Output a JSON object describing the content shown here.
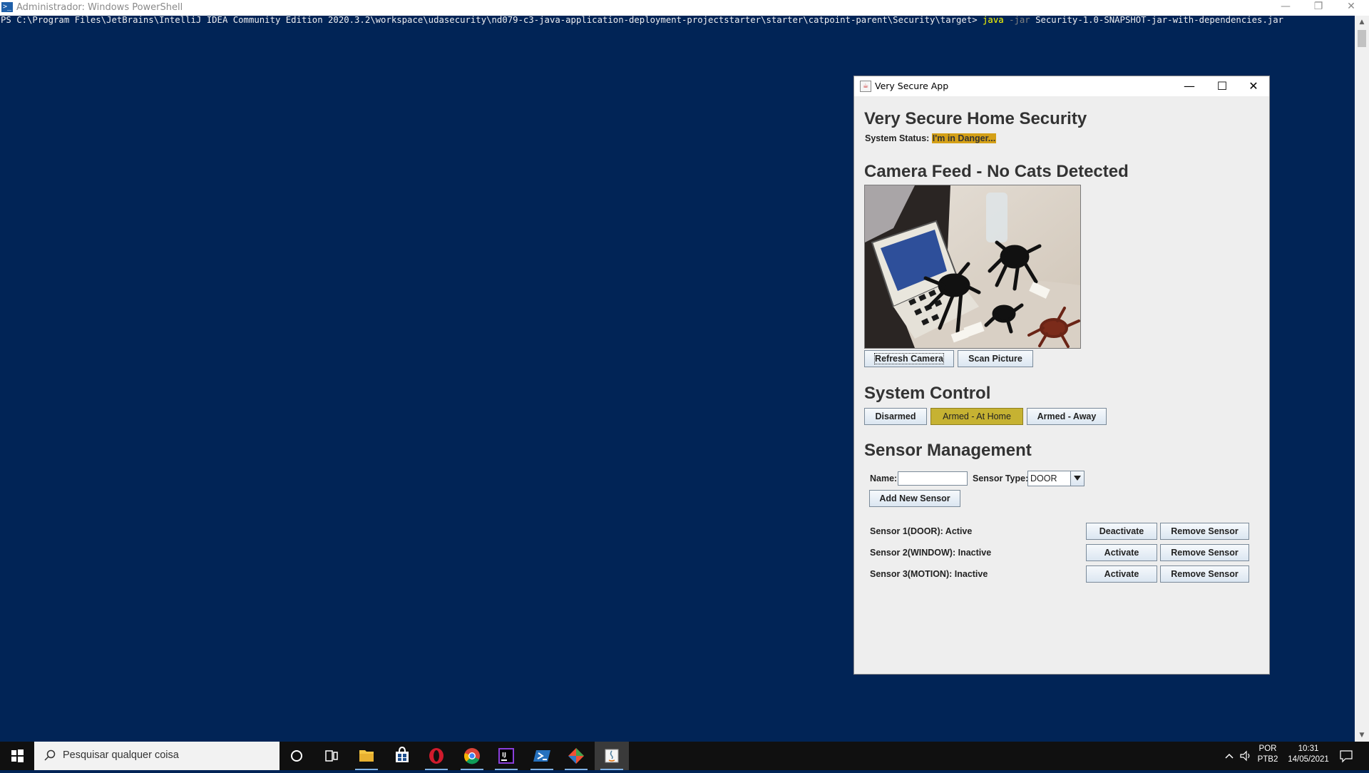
{
  "powershell": {
    "title": "Administrador: Windows PowerShell",
    "prompt": "PS C:\\Program Files\\JetBrains\\IntelliJ IDEA Community Edition 2020.3.2\\workspace\\udasecurity\\nd079-c3-java-application-deployment-projectstarter\\starter\\catpoint-parent\\Security\\target> ",
    "command": "java",
    "param": "-jar",
    "argument": "Security-1.0-SNAPSHOT-jar-with-dependencies.jar",
    "minimize": "—",
    "restore": "❐",
    "close": "✕"
  },
  "app": {
    "title": "Very Secure App",
    "minimize": "—",
    "maximize": "☐",
    "close": "✕",
    "heading": "Very Secure Home Security",
    "status_label": "System Status:",
    "status_value": "I'm in Danger...",
    "camera_heading": "Camera Feed - No Cats Detected",
    "refresh_camera": "Refresh Camera",
    "scan_picture": "Scan Picture",
    "system_control_heading": "System Control",
    "btn_disarmed": "Disarmed",
    "btn_armed_home": "Armed - At Home",
    "btn_armed_away": "Armed - Away",
    "sensor_heading": "Sensor Management",
    "name_label": "Name:",
    "name_value": "",
    "sensor_type_label": "Sensor Type:",
    "sensor_type_value": "DOOR",
    "add_sensor": "Add New Sensor",
    "sensors": [
      {
        "label": "Sensor 1(DOOR): Active",
        "toggle": "Deactivate",
        "remove": "Remove Sensor"
      },
      {
        "label": "Sensor 2(WINDOW): Inactive",
        "toggle": "Activate",
        "remove": "Remove Sensor"
      },
      {
        "label": "Sensor 3(MOTION): Inactive",
        "toggle": "Activate",
        "remove": "Remove Sensor"
      }
    ],
    "colors": {
      "status_highlight": "#d4a017",
      "armed_selected": "#c6b232"
    }
  },
  "taskbar": {
    "search_placeholder": "Pesquisar qualquer coisa",
    "language_top": "POR",
    "language_bottom": "PTB2",
    "time": "10:31",
    "date": "14/05/2021",
    "icons": [
      "start-icon",
      "search-icon",
      "cortana-icon",
      "task-view-icon",
      "file-explorer-icon",
      "store-icon",
      "opera-icon",
      "chrome-icon",
      "intellij-icon",
      "powershell-icon",
      "git-icon",
      "java-icon",
      "tray-chevron-icon",
      "volume-icon",
      "notification-icon"
    ]
  }
}
